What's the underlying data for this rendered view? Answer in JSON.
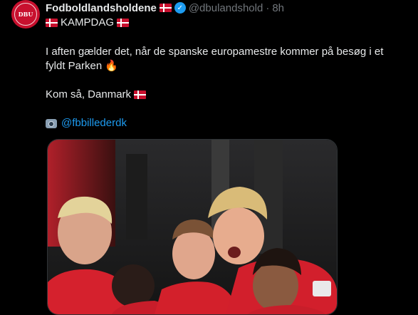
{
  "author": {
    "name": "Fodboldlandsholdene",
    "handle": "@dbulandshold",
    "separator": "·",
    "time": "8h",
    "avatar_text": "DBU",
    "verified_icon": "✓"
  },
  "tweet": {
    "line1": "KAMPDAG",
    "paragraph1": "I aften gælder det, når de spanske europamestre kommer på besøg i et fyldt Parken",
    "fire_emoji": "🔥",
    "paragraph2": "Kom så, Danmark",
    "photo_credit": "@fbbillederdk"
  },
  "colors": {
    "background": "#000000",
    "text": "#e7e9ea",
    "muted": "#71767b",
    "link": "#1d9bf0",
    "danish_red": "#c8102e"
  }
}
